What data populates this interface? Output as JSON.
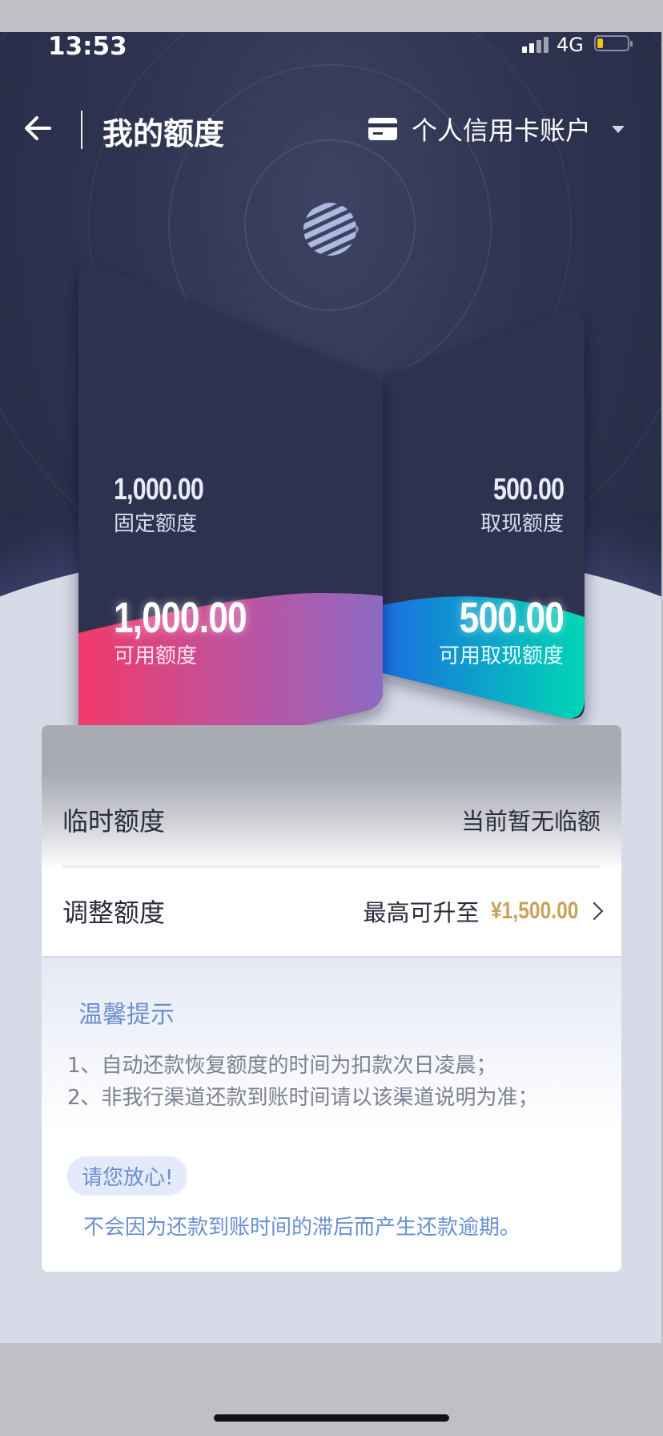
{
  "status_bar": {
    "time": "13:53",
    "network": "4G"
  },
  "header": {
    "title": "我的额度",
    "account_selector": "个人信用卡账户"
  },
  "cards": {
    "fixed": {
      "amount": "1,000.00",
      "label": "固定额度"
    },
    "available": {
      "amount": "1,000.00",
      "label": "可用额度"
    },
    "cash": {
      "amount": "500.00",
      "label": "取现额度"
    },
    "available_cash": {
      "amount": "500.00",
      "label": "可用取现额度"
    }
  },
  "temp_limit": {
    "label": "临时额度",
    "value": "当前暂无临额"
  },
  "adjust": {
    "label": "调整额度",
    "prefix": "最高可升至",
    "amount": "¥1,500.00"
  },
  "tips": {
    "title": "温馨提示",
    "lines": [
      "1、自动还款恢复额度的时间为扣款次日凌晨；",
      "2、非我行渠道还款到账时间请以该渠道说明为准；"
    ],
    "badge": "请您放心!",
    "assurance": "不会因为还款到账时间的滞后而产生还款逾期。"
  },
  "colors": {
    "header_bg": "#2e3350",
    "accent_blue": "#6a8fd2",
    "gold": "#c9a259",
    "card_left_gradient": [
      "#f23a6a",
      "#8e6ac2"
    ],
    "card_right_gradient": [
      "#1a6fe0",
      "#00d6b4"
    ]
  },
  "icons": [
    "back-arrow-icon",
    "credit-card-icon",
    "caret-down-icon",
    "bank-logo-icon",
    "chevron-right-icon",
    "signal-icon",
    "battery-icon"
  ]
}
